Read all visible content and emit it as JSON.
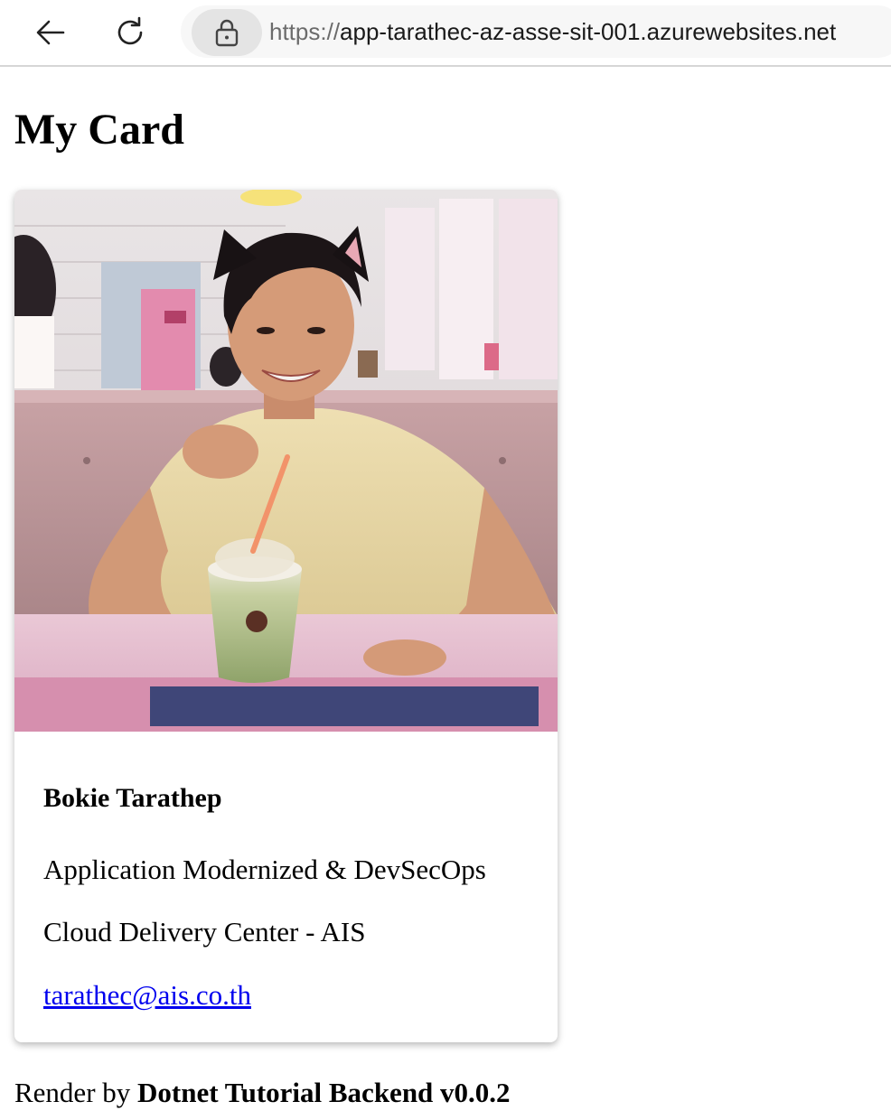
{
  "browser": {
    "url_scheme": "https://",
    "url_host": "app-tarathec-az-asse-sit-001.azurewebsites.net",
    "icons": {
      "back": "back-arrow-icon",
      "reload": "reload-icon",
      "lock": "lock-icon"
    }
  },
  "page": {
    "title": "My Card"
  },
  "card": {
    "photo_icon": "profile-photo",
    "name": "Bokie Tarathep",
    "role": "Application Modernized & DevSecOps",
    "organization": "Cloud Delivery Center - AIS",
    "email": "tarathec@ais.co.th"
  },
  "footer": {
    "prefix": "Render by",
    "app_name": "Dotnet Tutorial Backend v0.0.2"
  }
}
